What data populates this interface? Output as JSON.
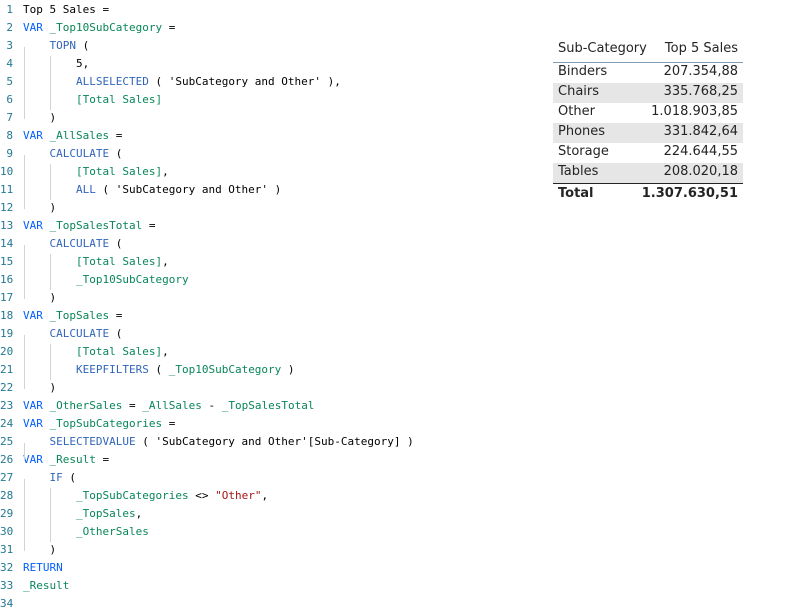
{
  "editor": {
    "lines": [
      {
        "n": "1",
        "segs": [
          [
            "plain",
            "Top 5 Sales ="
          ]
        ]
      },
      {
        "n": "2",
        "segs": [
          [
            "kw",
            "VAR "
          ],
          [
            "vr",
            "_Top10SubCategory"
          ],
          [
            "plain",
            " ="
          ]
        ]
      },
      {
        "n": "3",
        "segs": [
          [
            "plain",
            "    "
          ],
          [
            "fn",
            "TOPN"
          ],
          [
            "plain",
            " ("
          ]
        ]
      },
      {
        "n": "4",
        "segs": [
          [
            "plain",
            "        5,"
          ]
        ]
      },
      {
        "n": "5",
        "segs": [
          [
            "plain",
            "        "
          ],
          [
            "fn",
            "ALLSELECTED"
          ],
          [
            "plain",
            " ( 'SubCategory and Other' ),"
          ]
        ]
      },
      {
        "n": "6",
        "segs": [
          [
            "plain",
            "        "
          ],
          [
            "vr",
            "[Total Sales]"
          ]
        ]
      },
      {
        "n": "7",
        "segs": [
          [
            "plain",
            "    )"
          ]
        ]
      },
      {
        "n": "8",
        "segs": [
          [
            "kw",
            "VAR "
          ],
          [
            "vr",
            "_AllSales"
          ],
          [
            "plain",
            " ="
          ]
        ]
      },
      {
        "n": "9",
        "segs": [
          [
            "plain",
            "    "
          ],
          [
            "fn",
            "CALCULATE"
          ],
          [
            "plain",
            " ("
          ]
        ]
      },
      {
        "n": "10",
        "segs": [
          [
            "plain",
            "        "
          ],
          [
            "vr",
            "[Total Sales]"
          ],
          [
            "plain",
            ","
          ]
        ]
      },
      {
        "n": "11",
        "segs": [
          [
            "plain",
            "        "
          ],
          [
            "fn",
            "ALL"
          ],
          [
            "plain",
            " ( 'SubCategory and Other' )"
          ]
        ]
      },
      {
        "n": "12",
        "segs": [
          [
            "plain",
            "    )"
          ]
        ]
      },
      {
        "n": "13",
        "segs": [
          [
            "kw",
            "VAR "
          ],
          [
            "vr",
            "_TopSalesTotal"
          ],
          [
            "plain",
            " ="
          ]
        ]
      },
      {
        "n": "14",
        "segs": [
          [
            "plain",
            "    "
          ],
          [
            "fn",
            "CALCULATE"
          ],
          [
            "plain",
            " ("
          ]
        ]
      },
      {
        "n": "15",
        "segs": [
          [
            "plain",
            "        "
          ],
          [
            "vr",
            "[Total Sales]"
          ],
          [
            "plain",
            ","
          ]
        ]
      },
      {
        "n": "16",
        "segs": [
          [
            "plain",
            "        "
          ],
          [
            "vr",
            "_Top10SubCategory"
          ]
        ]
      },
      {
        "n": "17",
        "segs": [
          [
            "plain",
            "    )"
          ]
        ]
      },
      {
        "n": "18",
        "segs": [
          [
            "kw",
            "VAR "
          ],
          [
            "vr",
            "_TopSales"
          ],
          [
            "plain",
            " ="
          ]
        ]
      },
      {
        "n": "19",
        "segs": [
          [
            "plain",
            "    "
          ],
          [
            "fn",
            "CALCULATE"
          ],
          [
            "plain",
            " ("
          ]
        ]
      },
      {
        "n": "20",
        "segs": [
          [
            "plain",
            "        "
          ],
          [
            "vr",
            "[Total Sales]"
          ],
          [
            "plain",
            ","
          ]
        ]
      },
      {
        "n": "21",
        "segs": [
          [
            "plain",
            "        "
          ],
          [
            "fn",
            "KEEPFILTERS"
          ],
          [
            "plain",
            " ( "
          ],
          [
            "vr",
            "_Top10SubCategory"
          ],
          [
            "plain",
            " )"
          ]
        ]
      },
      {
        "n": "22",
        "segs": [
          [
            "plain",
            "    )"
          ]
        ]
      },
      {
        "n": "23",
        "segs": [
          [
            "kw",
            "VAR "
          ],
          [
            "vr",
            "_OtherSales"
          ],
          [
            "plain",
            " = "
          ],
          [
            "vr",
            "_AllSales"
          ],
          [
            "plain",
            " - "
          ],
          [
            "vr",
            "_TopSalesTotal"
          ]
        ]
      },
      {
        "n": "24",
        "segs": [
          [
            "kw",
            "VAR "
          ],
          [
            "vr",
            "_TopSubCategories"
          ],
          [
            "plain",
            " ="
          ]
        ]
      },
      {
        "n": "25",
        "segs": [
          [
            "plain",
            "    "
          ],
          [
            "fn",
            "SELECTEDVALUE"
          ],
          [
            "plain",
            " ( 'SubCategory and Other'[Sub-Category] )"
          ]
        ]
      },
      {
        "n": "26",
        "segs": [
          [
            "kw",
            "VAR "
          ],
          [
            "vr",
            "_Result"
          ],
          [
            "plain",
            " ="
          ]
        ]
      },
      {
        "n": "27",
        "segs": [
          [
            "plain",
            "    "
          ],
          [
            "fn",
            "IF"
          ],
          [
            "plain",
            " ("
          ]
        ]
      },
      {
        "n": "28",
        "segs": [
          [
            "plain",
            "        "
          ],
          [
            "vr",
            "_TopSubCategories"
          ],
          [
            "plain",
            " <> "
          ],
          [
            "str",
            "\"Other\""
          ],
          [
            "plain",
            ","
          ]
        ]
      },
      {
        "n": "29",
        "segs": [
          [
            "plain",
            "        "
          ],
          [
            "vr",
            "_TopSales"
          ],
          [
            "plain",
            ","
          ]
        ]
      },
      {
        "n": "30",
        "segs": [
          [
            "plain",
            "        "
          ],
          [
            "vr",
            "_OtherSales"
          ]
        ]
      },
      {
        "n": "31",
        "segs": [
          [
            "plain",
            "    )"
          ]
        ]
      },
      {
        "n": "32",
        "segs": [
          [
            "kw",
            "RETURN"
          ]
        ]
      },
      {
        "n": "33",
        "segs": [
          [
            "plain",
            ""
          ],
          [
            "vr",
            "_Result"
          ]
        ]
      },
      {
        "n": "34",
        "segs": []
      }
    ]
  },
  "table": {
    "headers": {
      "category": "Sub-Category",
      "value": "Top 5 Sales"
    },
    "rows": [
      {
        "category": "Binders",
        "value": "207.354,88"
      },
      {
        "category": "Chairs",
        "value": "335.768,25"
      },
      {
        "category": "Other",
        "value": "1.018.903,85"
      },
      {
        "category": "Phones",
        "value": "331.842,64"
      },
      {
        "category": "Storage",
        "value": "224.644,55"
      },
      {
        "category": "Tables",
        "value": "208.020,18"
      }
    ],
    "total": {
      "label": "Total",
      "value": "1.307.630,51"
    }
  },
  "colors": {
    "keyword": "#035efc",
    "function": "#3165bb",
    "variable": "#098658",
    "string": "#a31515",
    "line_number": "#237893",
    "alt_row": "#e6e6e6"
  }
}
